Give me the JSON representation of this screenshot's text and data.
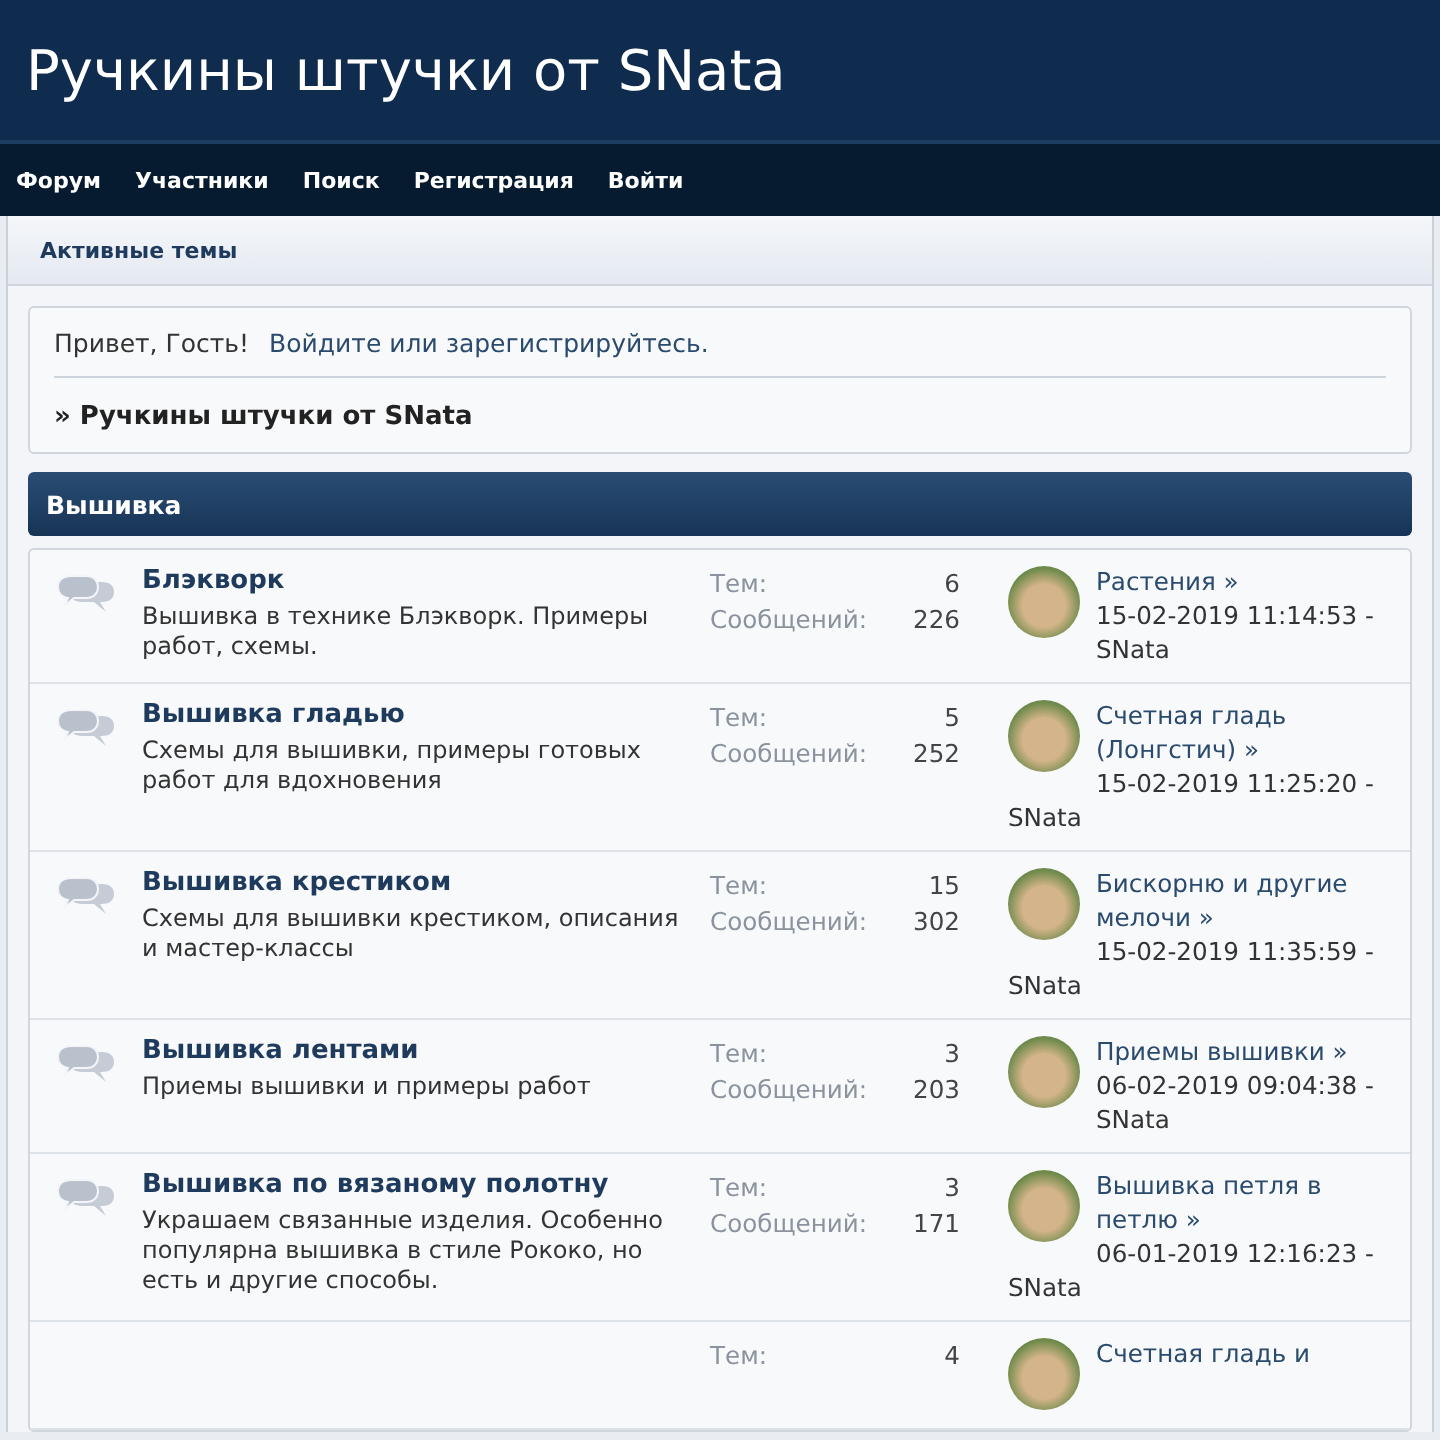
{
  "header": {
    "title": "Ручкины штучки от SNata"
  },
  "nav": [
    "Форум",
    "Участники",
    "Поиск",
    "Регистрация",
    "Войти"
  ],
  "subnav": "Активные темы",
  "welcome": {
    "greeting": "Привет, Гость!",
    "link": "Войдите или зарегистрируйтесь."
  },
  "breadcrumb": "» Ручкины штучки от SNata",
  "category": "Вышивка",
  "boards": [
    {
      "name": "Блэкворк",
      "description": "Вышивка в технике Блэкворк. Примеры работ, схемы.",
      "topics_label": "Тем:",
      "topics": "6",
      "posts_label": "Сообщений:",
      "posts": "226",
      "last_post": {
        "title": "Растения »",
        "date": "15-02-2019 11:14:53 -",
        "author": "SNata"
      }
    },
    {
      "name": "Вышивка гладью",
      "description": "Схемы для вышивки, примеры готовых работ для вдохновения",
      "topics_label": "Тем:",
      "topics": "5",
      "posts_label": "Сообщений:",
      "posts": "252",
      "last_post": {
        "title": "Счетная гладь (Лонгстич) »",
        "date": "15-02-2019 11:25:20 -",
        "author": "SNata"
      }
    },
    {
      "name": "Вышивка крестиком",
      "description": "Схемы для вышивки крестиком, описания и мастер-классы",
      "topics_label": "Тем:",
      "topics": "15",
      "posts_label": "Сообщений:",
      "posts": "302",
      "last_post": {
        "title": "Бискорню и другие мелочи »",
        "date": "15-02-2019 11:35:59 -",
        "author": "SNata"
      }
    },
    {
      "name": "Вышивка лентами",
      "description": "Приемы вышивки и примеры работ",
      "topics_label": "Тем:",
      "topics": "3",
      "posts_label": "Сообщений:",
      "posts": "203",
      "last_post": {
        "title": "Приемы вышивки »",
        "date": "06-02-2019 09:04:38 -",
        "author": "SNata"
      }
    },
    {
      "name": "Вышивка по вязаному полотну",
      "description": "Украшаем связанные изделия. Особенно популярна вышивка в стиле Рококо, но есть и другие способы.",
      "topics_label": "Тем:",
      "topics": "3",
      "posts_label": "Сообщений:",
      "posts": "171",
      "last_post": {
        "title": "Вышивка петля в петлю »",
        "date": "06-01-2019 12:16:23 -",
        "author": "SNata"
      }
    },
    {
      "topics_label": "Тем:",
      "topics": "4",
      "last_post": {
        "title": "Счетная гладь и"
      }
    }
  ]
}
